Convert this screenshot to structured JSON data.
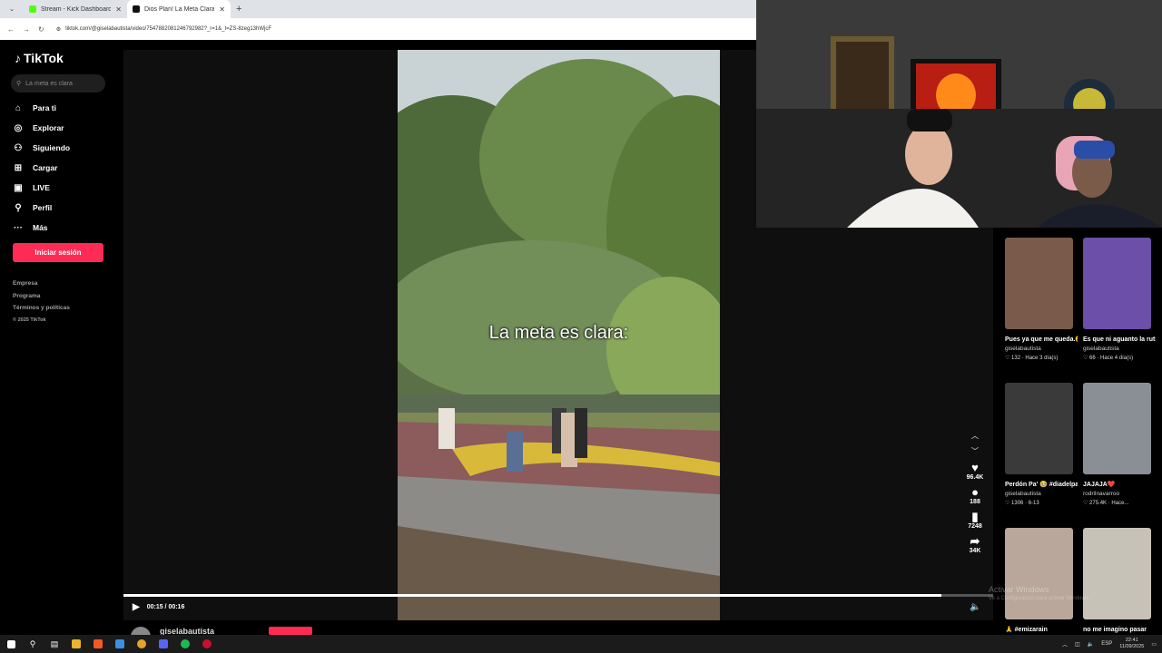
{
  "browser": {
    "tabs": [
      {
        "title": "Stream - Kick Dashboard",
        "favicon_color": "#53fc18",
        "active": false
      },
      {
        "title": "Dios Plan! La Meta Clara para l",
        "favicon_color": "#111111",
        "active": true
      }
    ],
    "new_tab": "+",
    "url": "tiktok.com/@giselabautista/video/7547882081246792982?_r=1&_t=ZS-8zeg13hWjcF"
  },
  "tiktok": {
    "logo": "TikTok",
    "search_placeholder": "La meta es clara",
    "nav": [
      {
        "label": "Para ti",
        "icon": "home-icon",
        "glyph": "⌂"
      },
      {
        "label": "Explorar",
        "icon": "compass-icon",
        "glyph": "◎"
      },
      {
        "label": "Siguiendo",
        "icon": "following-icon",
        "glyph": "⚇"
      },
      {
        "label": "Cargar",
        "icon": "upload-icon",
        "glyph": "⊞"
      },
      {
        "label": "LIVE",
        "icon": "live-icon",
        "glyph": "▣"
      },
      {
        "label": "Perfil",
        "icon": "profile-icon",
        "glyph": "⚲"
      },
      {
        "label": "Más",
        "icon": "more-icon",
        "glyph": "···"
      }
    ],
    "login_button": "Iniciar sesión",
    "footer": [
      "Empresa",
      "Programa",
      "Términos y políticas",
      "© 2025 TikTok"
    ],
    "brand_color": "#fe2c55"
  },
  "video": {
    "overlay_text": "La meta es clara:",
    "current_time": "00:15",
    "duration": "00:16",
    "time_display": "00:15 / 00:16",
    "progress": 0.94,
    "author": "giselabautista"
  },
  "actions": [
    {
      "name": "like",
      "icon": "heart-icon",
      "glyph": "♥",
      "count": "96.4K"
    },
    {
      "name": "comment",
      "icon": "comment-icon",
      "glyph": "●",
      "count": "188"
    },
    {
      "name": "bookmark",
      "icon": "bookmark-icon",
      "glyph": "▮",
      "count": "7248"
    },
    {
      "name": "share",
      "icon": "share-icon",
      "glyph": "➦",
      "count": "34K"
    }
  ],
  "related": [
    {
      "title": "Pues ya que me queda.😅 #imissu...",
      "user": "giselabautista",
      "stats": "♡ 132 · Hace 3 día(s)",
      "thumb_color": "#7a5a4a"
    },
    {
      "title": "Es que ni aguanto la rutina🫠",
      "user": "giselabautista",
      "stats": "♡ 66 · Hace 4 día(s)",
      "thumb_color": "#6b4fa8"
    },
    {
      "title": "Perdón Pa' 🥹 #diadelpadre #pap...",
      "user": "giselabautista",
      "stats": "♡ 1306 · 6-13",
      "thumb_color": "#3a3a3a"
    },
    {
      "title": "JAJAJA❤️",
      "user": "rodrilnavarroo",
      "stats": "♡ 275.4K · Hace...",
      "thumb_color": "#8a8f96"
    },
    {
      "title": "🙏 #emizarain",
      "user": "",
      "stats": "",
      "thumb_color": "#b8a79a"
    },
    {
      "title": "no me imagino pasar",
      "user": "",
      "stats": "",
      "thumb_color": "#c7c2b8"
    }
  ],
  "watermark": {
    "line1": "Activar Windows",
    "line2": "Ve a Configuración para activar Windows."
  },
  "taskbar": {
    "lang": "ESP",
    "time": "22:41",
    "date": "11/09/2025"
  }
}
